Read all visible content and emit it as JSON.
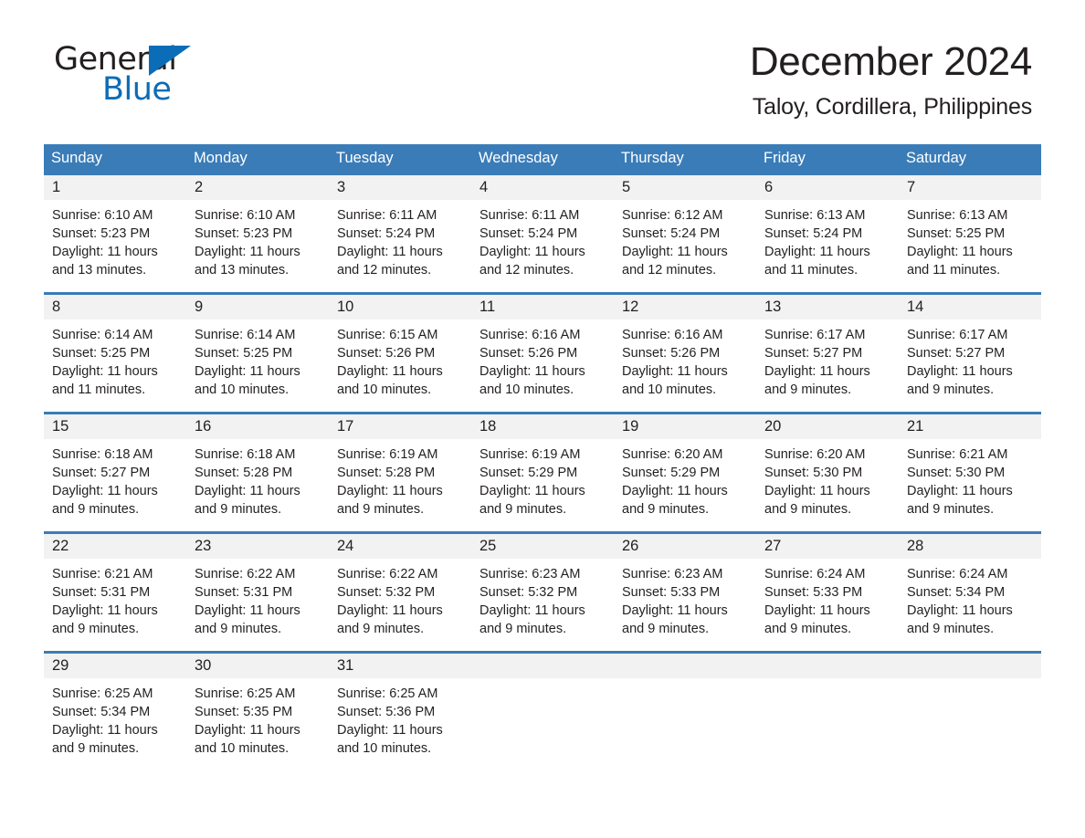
{
  "logo": {
    "word1": "General",
    "word2": "Blue",
    "triangle_color": "#0b6cb7"
  },
  "header": {
    "title": "December 2024",
    "subtitle": "Taloy, Cordillera, Philippines"
  },
  "theme": {
    "header_blue": "#3a7cb8",
    "daynum_bg": "#f2f2f2",
    "text": "#231f20"
  },
  "weekdays": [
    "Sunday",
    "Monday",
    "Tuesday",
    "Wednesday",
    "Thursday",
    "Friday",
    "Saturday"
  ],
  "weeks": [
    [
      {
        "day": "1",
        "sunrise": "Sunrise: 6:10 AM",
        "sunset": "Sunset: 5:23 PM",
        "daylight_1": "Daylight: 11 hours",
        "daylight_2": "and 13 minutes."
      },
      {
        "day": "2",
        "sunrise": "Sunrise: 6:10 AM",
        "sunset": "Sunset: 5:23 PM",
        "daylight_1": "Daylight: 11 hours",
        "daylight_2": "and 13 minutes."
      },
      {
        "day": "3",
        "sunrise": "Sunrise: 6:11 AM",
        "sunset": "Sunset: 5:24 PM",
        "daylight_1": "Daylight: 11 hours",
        "daylight_2": "and 12 minutes."
      },
      {
        "day": "4",
        "sunrise": "Sunrise: 6:11 AM",
        "sunset": "Sunset: 5:24 PM",
        "daylight_1": "Daylight: 11 hours",
        "daylight_2": "and 12 minutes."
      },
      {
        "day": "5",
        "sunrise": "Sunrise: 6:12 AM",
        "sunset": "Sunset: 5:24 PM",
        "daylight_1": "Daylight: 11 hours",
        "daylight_2": "and 12 minutes."
      },
      {
        "day": "6",
        "sunrise": "Sunrise: 6:13 AM",
        "sunset": "Sunset: 5:24 PM",
        "daylight_1": "Daylight: 11 hours",
        "daylight_2": "and 11 minutes."
      },
      {
        "day": "7",
        "sunrise": "Sunrise: 6:13 AM",
        "sunset": "Sunset: 5:25 PM",
        "daylight_1": "Daylight: 11 hours",
        "daylight_2": "and 11 minutes."
      }
    ],
    [
      {
        "day": "8",
        "sunrise": "Sunrise: 6:14 AM",
        "sunset": "Sunset: 5:25 PM",
        "daylight_1": "Daylight: 11 hours",
        "daylight_2": "and 11 minutes."
      },
      {
        "day": "9",
        "sunrise": "Sunrise: 6:14 AM",
        "sunset": "Sunset: 5:25 PM",
        "daylight_1": "Daylight: 11 hours",
        "daylight_2": "and 10 minutes."
      },
      {
        "day": "10",
        "sunrise": "Sunrise: 6:15 AM",
        "sunset": "Sunset: 5:26 PM",
        "daylight_1": "Daylight: 11 hours",
        "daylight_2": "and 10 minutes."
      },
      {
        "day": "11",
        "sunrise": "Sunrise: 6:16 AM",
        "sunset": "Sunset: 5:26 PM",
        "daylight_1": "Daylight: 11 hours",
        "daylight_2": "and 10 minutes."
      },
      {
        "day": "12",
        "sunrise": "Sunrise: 6:16 AM",
        "sunset": "Sunset: 5:26 PM",
        "daylight_1": "Daylight: 11 hours",
        "daylight_2": "and 10 minutes."
      },
      {
        "day": "13",
        "sunrise": "Sunrise: 6:17 AM",
        "sunset": "Sunset: 5:27 PM",
        "daylight_1": "Daylight: 11 hours",
        "daylight_2": "and 9 minutes."
      },
      {
        "day": "14",
        "sunrise": "Sunrise: 6:17 AM",
        "sunset": "Sunset: 5:27 PM",
        "daylight_1": "Daylight: 11 hours",
        "daylight_2": "and 9 minutes."
      }
    ],
    [
      {
        "day": "15",
        "sunrise": "Sunrise: 6:18 AM",
        "sunset": "Sunset: 5:27 PM",
        "daylight_1": "Daylight: 11 hours",
        "daylight_2": "and 9 minutes."
      },
      {
        "day": "16",
        "sunrise": "Sunrise: 6:18 AM",
        "sunset": "Sunset: 5:28 PM",
        "daylight_1": "Daylight: 11 hours",
        "daylight_2": "and 9 minutes."
      },
      {
        "day": "17",
        "sunrise": "Sunrise: 6:19 AM",
        "sunset": "Sunset: 5:28 PM",
        "daylight_1": "Daylight: 11 hours",
        "daylight_2": "and 9 minutes."
      },
      {
        "day": "18",
        "sunrise": "Sunrise: 6:19 AM",
        "sunset": "Sunset: 5:29 PM",
        "daylight_1": "Daylight: 11 hours",
        "daylight_2": "and 9 minutes."
      },
      {
        "day": "19",
        "sunrise": "Sunrise: 6:20 AM",
        "sunset": "Sunset: 5:29 PM",
        "daylight_1": "Daylight: 11 hours",
        "daylight_2": "and 9 minutes."
      },
      {
        "day": "20",
        "sunrise": "Sunrise: 6:20 AM",
        "sunset": "Sunset: 5:30 PM",
        "daylight_1": "Daylight: 11 hours",
        "daylight_2": "and 9 minutes."
      },
      {
        "day": "21",
        "sunrise": "Sunrise: 6:21 AM",
        "sunset": "Sunset: 5:30 PM",
        "daylight_1": "Daylight: 11 hours",
        "daylight_2": "and 9 minutes."
      }
    ],
    [
      {
        "day": "22",
        "sunrise": "Sunrise: 6:21 AM",
        "sunset": "Sunset: 5:31 PM",
        "daylight_1": "Daylight: 11 hours",
        "daylight_2": "and 9 minutes."
      },
      {
        "day": "23",
        "sunrise": "Sunrise: 6:22 AM",
        "sunset": "Sunset: 5:31 PM",
        "daylight_1": "Daylight: 11 hours",
        "daylight_2": "and 9 minutes."
      },
      {
        "day": "24",
        "sunrise": "Sunrise: 6:22 AM",
        "sunset": "Sunset: 5:32 PM",
        "daylight_1": "Daylight: 11 hours",
        "daylight_2": "and 9 minutes."
      },
      {
        "day": "25",
        "sunrise": "Sunrise: 6:23 AM",
        "sunset": "Sunset: 5:32 PM",
        "daylight_1": "Daylight: 11 hours",
        "daylight_2": "and 9 minutes."
      },
      {
        "day": "26",
        "sunrise": "Sunrise: 6:23 AM",
        "sunset": "Sunset: 5:33 PM",
        "daylight_1": "Daylight: 11 hours",
        "daylight_2": "and 9 minutes."
      },
      {
        "day": "27",
        "sunrise": "Sunrise: 6:24 AM",
        "sunset": "Sunset: 5:33 PM",
        "daylight_1": "Daylight: 11 hours",
        "daylight_2": "and 9 minutes."
      },
      {
        "day": "28",
        "sunrise": "Sunrise: 6:24 AM",
        "sunset": "Sunset: 5:34 PM",
        "daylight_1": "Daylight: 11 hours",
        "daylight_2": "and 9 minutes."
      }
    ],
    [
      {
        "day": "29",
        "sunrise": "Sunrise: 6:25 AM",
        "sunset": "Sunset: 5:34 PM",
        "daylight_1": "Daylight: 11 hours",
        "daylight_2": "and 9 minutes."
      },
      {
        "day": "30",
        "sunrise": "Sunrise: 6:25 AM",
        "sunset": "Sunset: 5:35 PM",
        "daylight_1": "Daylight: 11 hours",
        "daylight_2": "and 10 minutes."
      },
      {
        "day": "31",
        "sunrise": "Sunrise: 6:25 AM",
        "sunset": "Sunset: 5:36 PM",
        "daylight_1": "Daylight: 11 hours",
        "daylight_2": "and 10 minutes."
      },
      {
        "day": "",
        "sunrise": "",
        "sunset": "",
        "daylight_1": "",
        "daylight_2": ""
      },
      {
        "day": "",
        "sunrise": "",
        "sunset": "",
        "daylight_1": "",
        "daylight_2": ""
      },
      {
        "day": "",
        "sunrise": "",
        "sunset": "",
        "daylight_1": "",
        "daylight_2": ""
      },
      {
        "day": "",
        "sunrise": "",
        "sunset": "",
        "daylight_1": "",
        "daylight_2": ""
      }
    ]
  ]
}
